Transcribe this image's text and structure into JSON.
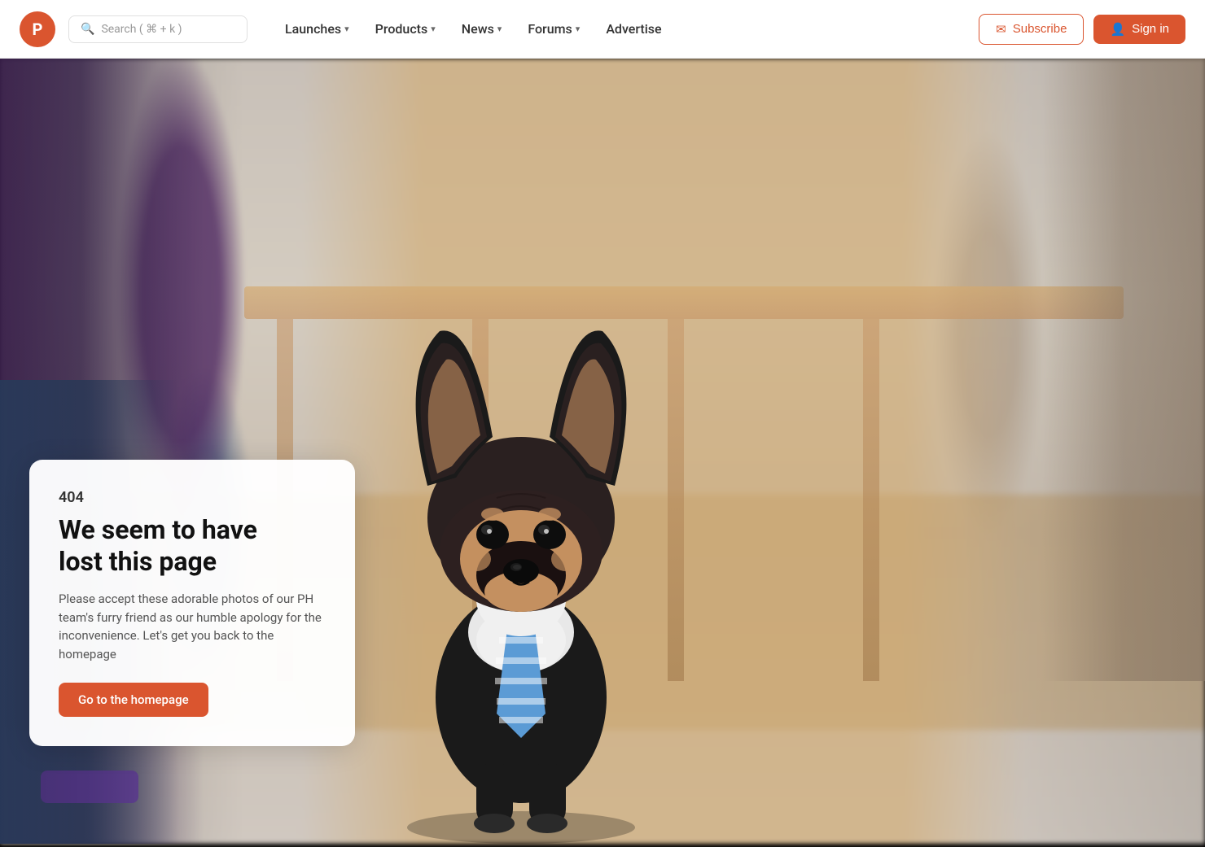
{
  "nav": {
    "logo_letter": "P",
    "search_placeholder": "Search ( ⌘ + k )",
    "links": [
      {
        "label": "Launches",
        "has_dropdown": true
      },
      {
        "label": "Products",
        "has_dropdown": true
      },
      {
        "label": "News",
        "has_dropdown": true
      },
      {
        "label": "Forums",
        "has_dropdown": true
      },
      {
        "label": "Advertise",
        "has_dropdown": false
      }
    ],
    "subscribe_label": "Subscribe",
    "signin_label": "Sign in"
  },
  "error": {
    "code": "404",
    "title_line1": "We seem to have",
    "title_line2": "lost this page",
    "description": "Please accept these adorable photos of our PH team's furry friend as our humble apology for the inconvenience. Let's get you back to the homepage",
    "cta_label": "Go to the homepage"
  },
  "colors": {
    "brand": "#da552f",
    "text_dark": "#111111",
    "text_medium": "#333333",
    "text_light": "#555555",
    "border": "#e0e0e0"
  }
}
